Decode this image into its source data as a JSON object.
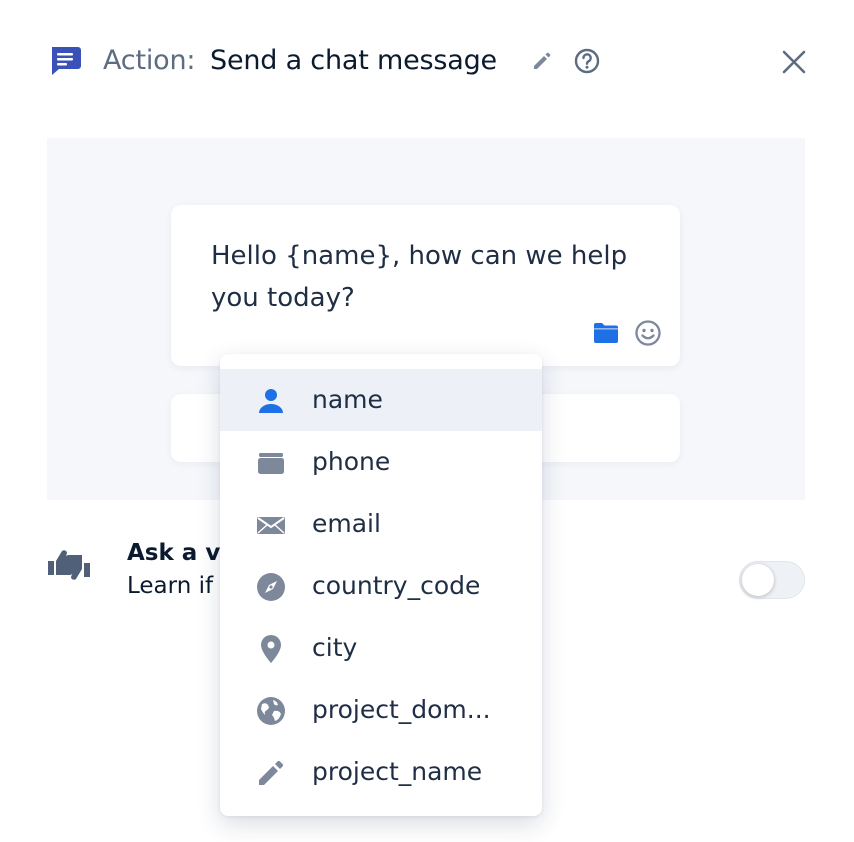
{
  "header": {
    "prefix": "Action:",
    "title": "Send a chat message"
  },
  "message": {
    "text": "Hello {name}, how can we help you today?"
  },
  "rating": {
    "title": "Ask a vis",
    "description": "Learn if",
    "enabled": false
  },
  "dropdown": {
    "items": [
      {
        "label": "name",
        "icon": "person-icon"
      },
      {
        "label": "phone",
        "icon": "phone-icon"
      },
      {
        "label": "email",
        "icon": "email-icon"
      },
      {
        "label": "country_code",
        "icon": "compass-icon"
      },
      {
        "label": "city",
        "icon": "location-pin-icon"
      },
      {
        "label": "project_dom...",
        "icon": "globe-icon"
      },
      {
        "label": "project_name",
        "icon": "pencil-icon"
      }
    ],
    "active_index": 0
  },
  "colors": {
    "accent": "#3a52b8",
    "folder": "#1f6fe5",
    "muted_icon": "#7d889b",
    "preview_bg": "#f5f7fb"
  }
}
